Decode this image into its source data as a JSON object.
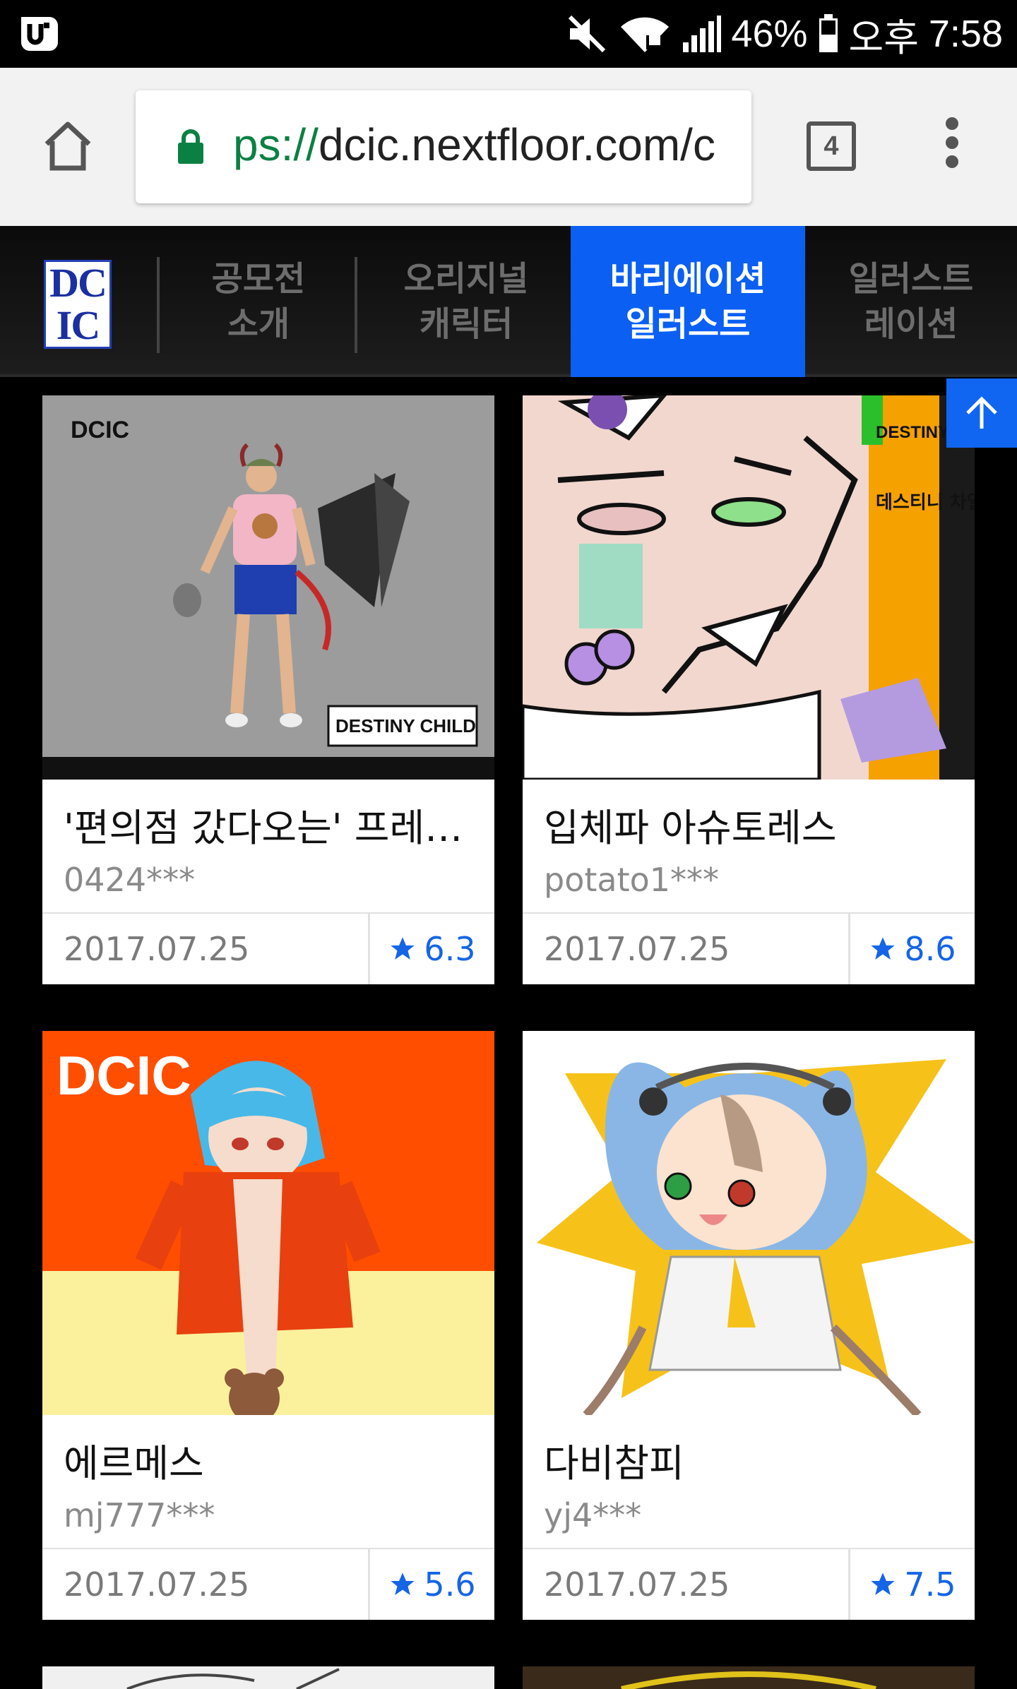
{
  "status_bar": {
    "battery_percent": "46%",
    "period": "오후",
    "time": "7:58",
    "icons": [
      "carrier-u-icon",
      "mute-icon",
      "wifi-icon",
      "signal-icon",
      "battery-icon"
    ]
  },
  "browser": {
    "url_scheme": "ps://",
    "url_rest": "dcic.nextfloor.com/c",
    "tab_count": "4"
  },
  "site_nav": {
    "logo_top": "DC",
    "logo_bottom": "IC",
    "items": [
      {
        "label": "공모전\n소개",
        "active": false
      },
      {
        "label": "오리지널\n캐릭터",
        "active": false
      },
      {
        "label": "바리에이션\n일러스트",
        "active": true
      },
      {
        "label": "일러스트\n레이션",
        "active": false
      }
    ]
  },
  "colors": {
    "accent": "#0b5ff3",
    "rating_blue": "#1565e6",
    "url_green": "#0b8043"
  },
  "gallery": [
    {
      "title": "'편의점 갔다오는' 프레이 …",
      "author": "0424***",
      "date": "2017.07.25",
      "rating": "6.3"
    },
    {
      "title": "입체파 아슈토레스",
      "author": "potato1***",
      "date": "2017.07.25",
      "rating": "8.6"
    },
    {
      "title": "에르메스",
      "author": "mj777***",
      "date": "2017.07.25",
      "rating": "5.6"
    },
    {
      "title": "다비참피",
      "author": "yj4***",
      "date": "2017.07.25",
      "rating": "7.5"
    }
  ],
  "artwork_text": {
    "contest_logo": "DCIC",
    "destiny_child": "DESTINY CHILD",
    "destiny_child_kr": "데스티니 차일드"
  }
}
